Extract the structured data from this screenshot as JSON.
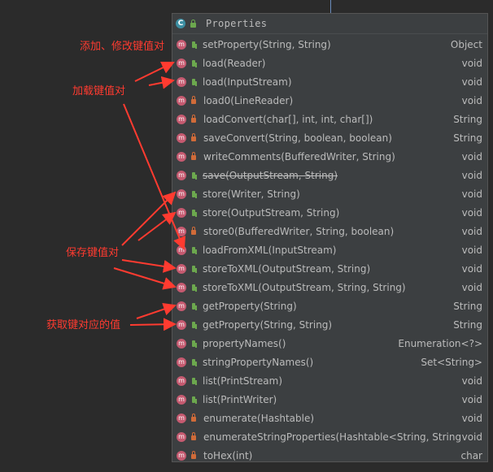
{
  "panel": {
    "title": "Properties",
    "class_icon_glyph": "C",
    "method_icon_glyph": "m"
  },
  "methods": [
    {
      "name": "setProperty(String, String)",
      "ret": "Object",
      "access": "public",
      "deprecated": false
    },
    {
      "name": "load(Reader)",
      "ret": "void",
      "access": "public",
      "deprecated": false
    },
    {
      "name": "load(InputStream)",
      "ret": "void",
      "access": "public",
      "deprecated": false
    },
    {
      "name": "load0(LineReader)",
      "ret": "void",
      "access": "private",
      "deprecated": false
    },
    {
      "name": "loadConvert(char[], int, int, char[])",
      "ret": "String",
      "access": "private",
      "deprecated": false
    },
    {
      "name": "saveConvert(String, boolean, boolean)",
      "ret": "String",
      "access": "private",
      "deprecated": false
    },
    {
      "name": "writeComments(BufferedWriter, String)",
      "ret": "void",
      "access": "private",
      "deprecated": false
    },
    {
      "name": "save(OutputStream, String)",
      "ret": "void",
      "access": "public",
      "deprecated": true
    },
    {
      "name": "store(Writer, String)",
      "ret": "void",
      "access": "public",
      "deprecated": false
    },
    {
      "name": "store(OutputStream, String)",
      "ret": "void",
      "access": "public",
      "deprecated": false
    },
    {
      "name": "store0(BufferedWriter, String, boolean)",
      "ret": "void",
      "access": "private",
      "deprecated": false
    },
    {
      "name": "loadFromXML(InputStream)",
      "ret": "void",
      "access": "public",
      "deprecated": false
    },
    {
      "name": "storeToXML(OutputStream, String)",
      "ret": "void",
      "access": "public",
      "deprecated": false
    },
    {
      "name": "storeToXML(OutputStream, String, String)",
      "ret": "void",
      "access": "public",
      "deprecated": false
    },
    {
      "name": "getProperty(String)",
      "ret": "String",
      "access": "public",
      "deprecated": false
    },
    {
      "name": "getProperty(String, String)",
      "ret": "String",
      "access": "public",
      "deprecated": false
    },
    {
      "name": "propertyNames()",
      "ret": "Enumeration<?>",
      "access": "public",
      "deprecated": false
    },
    {
      "name": "stringPropertyNames()",
      "ret": "Set<String>",
      "access": "public",
      "deprecated": false
    },
    {
      "name": "list(PrintStream)",
      "ret": "void",
      "access": "public",
      "deprecated": false
    },
    {
      "name": "list(PrintWriter)",
      "ret": "void",
      "access": "public",
      "deprecated": false
    },
    {
      "name": "enumerate(Hashtable)",
      "ret": "void",
      "access": "private",
      "deprecated": false
    },
    {
      "name": "enumerateStringProperties(Hashtable<String, String>)",
      "ret": "void",
      "access": "private",
      "deprecated": false
    },
    {
      "name": "toHex(int)",
      "ret": "char",
      "access": "private",
      "deprecated": false
    }
  ],
  "annotations": {
    "set": "添加、修改键值对",
    "load": "加载键值对",
    "store": "保存键值对",
    "get": "获取键对应的值"
  },
  "colors": {
    "background": "#2b2b2b",
    "panel": "#3c3f41",
    "text": "#bbbbbb",
    "method_icon": "#c55a70",
    "class_icon": "#3d8fa3",
    "public": "#6ca84e",
    "private": "#d06b39",
    "annotation": "#ff3b30"
  }
}
